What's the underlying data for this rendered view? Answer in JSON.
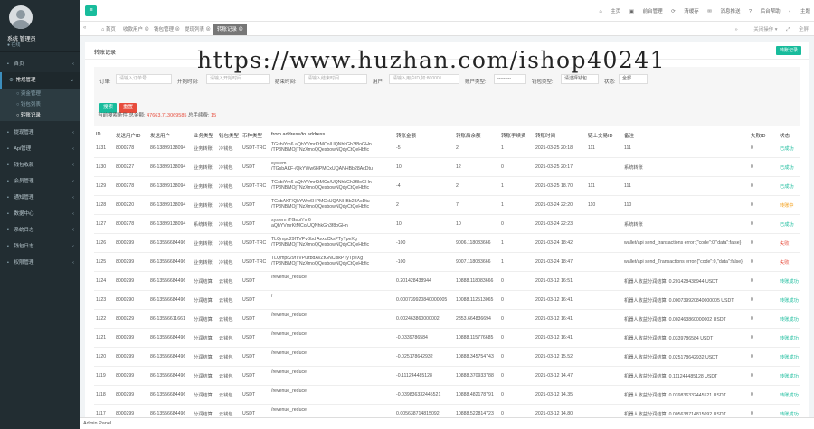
{
  "sidebar": {
    "user": {
      "name": "系统 管理员",
      "status": "● 在线"
    },
    "items": [
      {
        "label": "首页",
        "icon": "dashboard-icon"
      },
      {
        "label": "常规管理",
        "icon": "cog-icon"
      },
      {
        "label": "钱包管理",
        "icon": "wallet-icon"
      },
      {
        "label": "提现管理",
        "icon": "money-icon"
      },
      {
        "label": "Api管理",
        "icon": "api-icon"
      },
      {
        "label": "钱包收款",
        "icon": "qrcode-icon"
      },
      {
        "label": "会员管理",
        "icon": "user-icon"
      },
      {
        "label": "通知管理",
        "icon": "bell-icon"
      },
      {
        "label": "数据中心",
        "icon": "chart-icon"
      },
      {
        "label": "系统日志",
        "icon": "log-icon"
      },
      {
        "label": "钱包日志",
        "icon": "file-icon"
      },
      {
        "label": "权限管理",
        "icon": "lock-icon"
      }
    ],
    "sub_items": [
      "资金管理",
      "钱包列表",
      "转账记录"
    ]
  },
  "topbar": {
    "links": [
      "主页",
      "前台管理",
      "清缓存",
      "消息推送",
      "后台帮助",
      "主题"
    ]
  },
  "tabs": {
    "items": [
      "首页",
      "收款用户",
      "钱包管理",
      "提现列表",
      "转账记录"
    ],
    "right": [
      "关闭操作",
      "全屏"
    ]
  },
  "panel": {
    "title": "转账记录",
    "action": "转账记录"
  },
  "filters": {
    "labels": [
      "订单:",
      "开始时间:",
      "结束时间:",
      "用户:",
      "账户类型:",
      "钱包类型:",
      "状态:"
    ],
    "placeholders": [
      "请输入订单号",
      "请输入开始时间",
      "请输入结束时间",
      "请输入用户ID,如:800001"
    ],
    "selects": [
      "---------",
      "请选择钱包",
      "全部"
    ],
    "search_btn": "搜索",
    "reset_btn": "重置"
  },
  "stats": {
    "prefix": "当前搜索条件 总金额:",
    "amount": "47663.713069585",
    "count_label": "总手续费:",
    "count": "15"
  },
  "table": {
    "headers": [
      "ID",
      "发送用户ID",
      "发送用户",
      "业务类型",
      "钱包类型",
      "币种类型",
      "from address/to address",
      "转账金额",
      "转账后余额",
      "转账手续费",
      "转账时间",
      "链上交易ID",
      "备注",
      "失败ID",
      "状态"
    ],
    "rows": [
      [
        "1131",
        "8000278",
        "86-13899138094",
        "业务转账",
        "冷钱包",
        "USDT-TRC",
        "TGsbiYm6 aQhYVmrKtMCo/UQNhkGh3f8oGHn /TP3NBMOjTNzXmoQQesbowNQdyCtQeHbfic",
        "-5",
        "2",
        "1",
        "2021-03-25 20:18",
        "111",
        "111",
        "0",
        "已成功"
      ],
      [
        "1130",
        "8000227",
        "86-13899138094",
        "业务转账",
        "冷钱包",
        "USDT",
        "system /TGsbAKF-/QkYWw6HPMCxUQANHBb28AcDtu",
        "10",
        "12",
        "0",
        "2021-03-25 20:17",
        "",
        "系统转账",
        "0",
        "已成功"
      ],
      [
        "1129",
        "8000278",
        "86-13899138094",
        "业务转账",
        "冷钱包",
        "USDT-TRC",
        "TGsbiYm6 aQhYVmrKtMCo/UQNhkGh3f8oGHn /TP3NBMOjTNzXmoQQesbowNQdyCtQeHbfic",
        "-4",
        "2",
        "1",
        "2021-03-25 18.70",
        "111",
        "111",
        "0",
        "已成功"
      ],
      [
        "1128",
        "8000220",
        "86-13899138094",
        "业务转账",
        "冷钱包",
        "USDT",
        "TGsbAKF/QkYWw6HPMCxUQANHBb28AcDtu /TP3NBMOjTNzXmoQQesbowNQdyCtQeHbfic",
        "2",
        "7",
        "1",
        "2021-03-24 22:20",
        "110",
        "110",
        "0",
        "转账中"
      ],
      [
        "1127",
        "8000278",
        "86-13899138094",
        "系统转账",
        "冷钱包",
        "USDT",
        "system /TGsbiYm6 aQhYVmrKtMCo/UQNhkGh3f8oGHn",
        "10",
        "10",
        "0",
        "2021-03-24 22:23",
        "",
        "系统转账",
        "0",
        "已成功"
      ],
      [
        "1126",
        "8000299",
        "86-13556684496",
        "业务转账",
        "冷钱包",
        "USDT-TRC",
        "TLQmpc29fTVPvBbd AvxoCksPTyTpeXg /TP3NBMOjTNzXmoQQesbowNQdyCtQeHbfic",
        "-100",
        "9006.118083666",
        "1",
        "2021-03-24 18:42",
        "",
        "wallet/api send_transactions error:{\"code\":0,\"data\":false}",
        "0",
        "失败"
      ],
      [
        "1125",
        "8000299",
        "86-13556684496",
        "业务转账",
        "冷钱包",
        "USDT-TRC",
        "TLQmpc29fTVPuzbdAvZtGNClskPTyTpeXg /TP3NBMOjTNzXmoQQesbowNQdyCtQeHbfic",
        "-100",
        "9007.118083666",
        "1",
        "2021-03-24 18:47",
        "",
        "wallet/api send_Transactions error:{\"code\":0,\"data\":false}",
        "0",
        "失败"
      ],
      [
        "1124",
        "8000299",
        "86-13556684496",
        "分润结算",
        "云钱包",
        "USDT",
        "/revenue_reduce",
        "0.201428438944",
        "10888.118083666",
        "0",
        "2021-03-12 16:51",
        "",
        "机器人收益分润结算: 0.201428438944 USDT",
        "0",
        "转账成功"
      ],
      [
        "1123",
        "8000290",
        "86-13556684496",
        "分润结算",
        "云钱包",
        "USDT",
        "/",
        "0.000739920840000005",
        "10088.112513065",
        "0",
        "2021-03-12 16:41",
        "",
        "机器人收益分润结算: 0.000739920840000005 USDT",
        "0",
        "转账成功"
      ],
      [
        "1122",
        "8000229",
        "86-13556611661",
        "分润结算",
        "云钱包",
        "USDT",
        "/revenue_reduce",
        "0.002463860000002",
        "2853.664836694",
        "0",
        "2021-03-12 16:41",
        "",
        "机器人收益分润结算: 0.002463860000002 USDT",
        "0",
        "转账成功"
      ],
      [
        "1121",
        "8000299",
        "86-13556684496",
        "分润结算",
        "云钱包",
        "USDT",
        "/revenue_reduce",
        "-0.0339786584",
        "10888.115776685",
        "0",
        "2021-03-12 16:41",
        "",
        "机器人收益分润结算: 0.0339786584 USDT",
        "0",
        "转账成功"
      ],
      [
        "1120",
        "8000299",
        "86-13556684496",
        "分润结算",
        "云钱包",
        "USDT",
        "/revenue_reduce",
        "-0.025178642932",
        "10888.345754743",
        "0",
        "2021-03-12 15.52",
        "",
        "机器人收益分润结算: 0.025178642932 USDT",
        "0",
        "转账成功"
      ],
      [
        "1119",
        "8000299",
        "86-13556684496",
        "分润结算",
        "云钱包",
        "USDT",
        "/revenue_reduce",
        "-0.111244485128",
        "10888.370933788",
        "0",
        "2021-03-12 14.47",
        "",
        "机器人收益分润结算: 0.111244485128 USDT",
        "0",
        "转账成功"
      ],
      [
        "1118",
        "8000299",
        "86-13556684496",
        "分润结算",
        "云钱包",
        "USDT",
        "/revenue_reduce",
        "-0.039836332445521",
        "10888.482178791",
        "0",
        "2021-03-12 14.35",
        "",
        "机器人收益分润结算: 0.039836332445521 USDT",
        "0",
        "转账成功"
      ],
      [
        "1117",
        "8000299",
        "86-13556684496",
        "分润结算",
        "云钱包",
        "USDT",
        "/revenue_reduce",
        "0.005638714815092",
        "10888.522814723",
        "0",
        "2021-03-12 14.80",
        "",
        "机器人收益分润结算: 0.005638714815092 USDT",
        "0",
        "转账成功"
      ]
    ]
  },
  "footer": {
    "text": "Admin Panel"
  },
  "watermark": "https://www.huzhan.com/ishop40241"
}
